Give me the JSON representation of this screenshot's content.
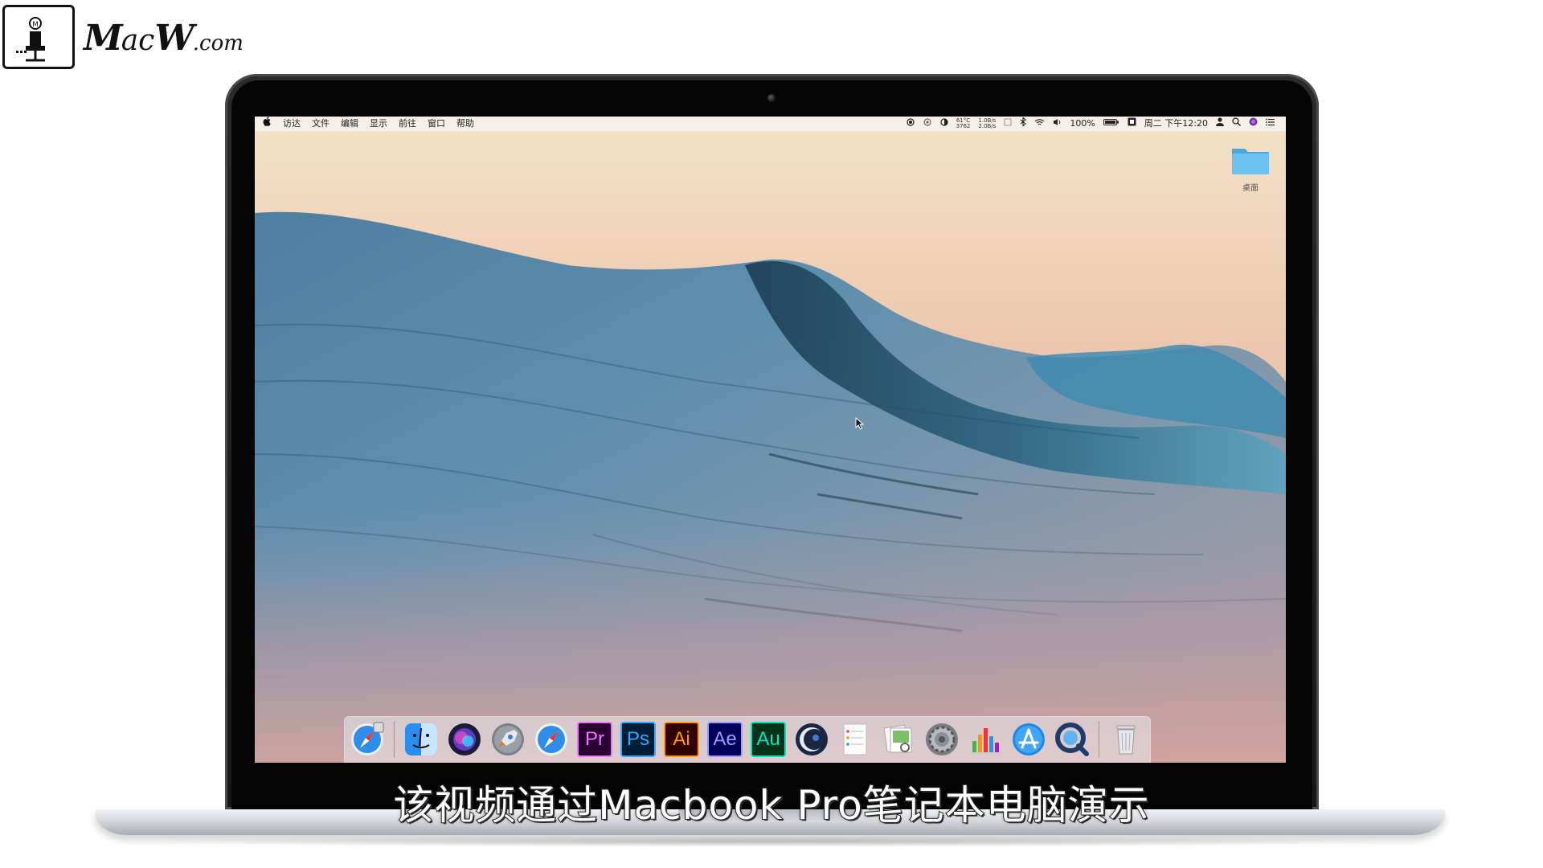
{
  "brand": {
    "logo_text_big": "M",
    "logo_text_mid": "ac",
    "logo_text_w": "W",
    "logo_text_dot": ".com",
    "icon": "macw-computer-logo-icon"
  },
  "menubar": {
    "apple_icon": "apple-icon",
    "items": [
      "访达",
      "文件",
      "编辑",
      "显示",
      "前往",
      "窗口",
      "帮助"
    ],
    "status": {
      "temp_top": "61°C",
      "temp_bottom": "3762",
      "net_top": "1.0B/s",
      "net_bottom": "2.0B/s",
      "battery": "100%",
      "datetime": "周二 下午12:20"
    }
  },
  "desktop": {
    "folder_label": "桌面"
  },
  "dock": {
    "items": [
      {
        "name": "safari-downloads",
        "icon": "safari-compass-icon"
      },
      {
        "name": "finder",
        "icon": "finder-icon"
      },
      {
        "name": "siri",
        "icon": "siri-icon"
      },
      {
        "name": "launchpad",
        "icon": "launchpad-rocket-icon"
      },
      {
        "name": "safari",
        "icon": "safari-compass-icon"
      },
      {
        "name": "premiere-pro",
        "label": "Pr"
      },
      {
        "name": "photoshop",
        "label": "Ps"
      },
      {
        "name": "illustrator",
        "label": "Ai"
      },
      {
        "name": "after-effects",
        "label": "Ae"
      },
      {
        "name": "audition",
        "label": "Au"
      },
      {
        "name": "cinema-4d",
        "icon": "cinema4d-icon"
      },
      {
        "name": "reminders",
        "icon": "notes-list-icon"
      },
      {
        "name": "preview",
        "icon": "preview-photos-icon"
      },
      {
        "name": "system-preferences",
        "icon": "gear-icon"
      },
      {
        "name": "numbers",
        "icon": "bar-chart-icon"
      },
      {
        "name": "app-store",
        "icon": "app-store-icon"
      },
      {
        "name": "quicktime",
        "icon": "quicktime-icon"
      },
      {
        "name": "trash",
        "icon": "trash-icon"
      }
    ]
  },
  "subtitle": "该视频通过Macbook Pro笔记本电脑演示",
  "colors": {
    "sky_top": "#f1dfc6",
    "sky_bottom": "#e8b6a2",
    "wave_dark": "#1f4759",
    "wave_light": "#6aa6c0",
    "folder": "#5bb7ea"
  }
}
